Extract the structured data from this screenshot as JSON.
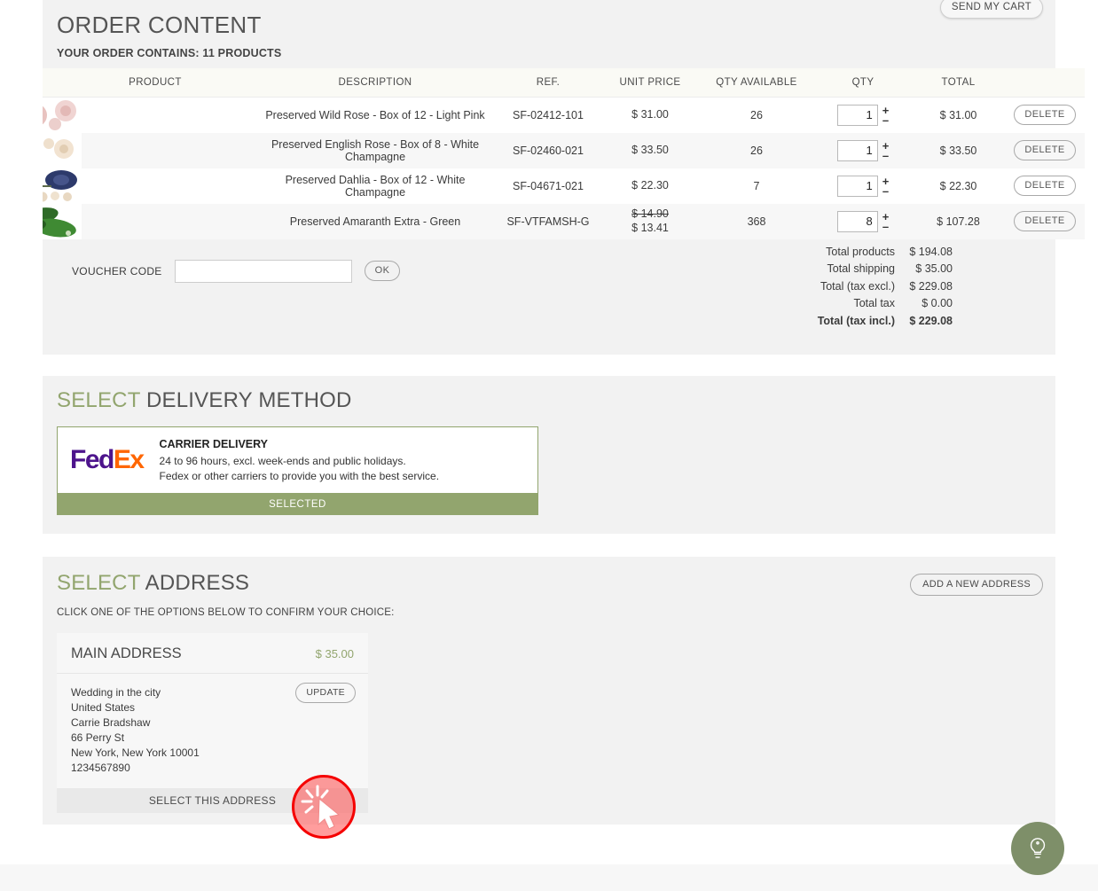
{
  "order": {
    "title": "ORDER CONTENT",
    "subtitle": "YOUR ORDER CONTAINS: 11 PRODUCTS",
    "send_cart_label": "SEND MY CART",
    "columns": {
      "product": "PRODUCT",
      "description": "DESCRIPTION",
      "ref": "REF.",
      "unit_price": "UNIT PRICE",
      "qty_available": "QTY AVAILABLE",
      "qty": "QTY",
      "total": "TOTAL"
    },
    "rows": [
      {
        "description": "Preserved Wild Rose - Box of 12 - Light Pink",
        "ref": "SF-02412-101",
        "unit_price": "$ 31.00",
        "unit_price_old": "",
        "qty_available": "26",
        "qty": "1",
        "total": "$ 31.00",
        "delete_label": "DELETE",
        "thumb": "pink-roses"
      },
      {
        "description": "Preserved English Rose - Box of 8 - White Champagne",
        "ref": "SF-02460-021",
        "unit_price": "$ 33.50",
        "unit_price_old": "",
        "qty_available": "26",
        "qty": "1",
        "total": "$ 33.50",
        "delete_label": "DELETE",
        "thumb": "cream-roses"
      },
      {
        "description": "Preserved Dahlia - Box of 12 - White Champagne",
        "ref": "SF-04671-021",
        "unit_price": "$ 22.30",
        "unit_price_old": "",
        "qty_available": "7",
        "qty": "1",
        "total": "$ 22.30",
        "delete_label": "DELETE",
        "thumb": "navy-dahlia"
      },
      {
        "description": "Preserved Amaranth Extra - Green",
        "ref": "SF-VTFAMSH-G",
        "unit_price": "$ 13.41",
        "unit_price_old": "$ 14.90",
        "qty_available": "368",
        "qty": "8",
        "total": "$ 107.28",
        "delete_label": "DELETE",
        "thumb": "green-amaranth"
      }
    ],
    "voucher": {
      "label": "VOUCHER CODE",
      "value": "",
      "placeholder": "",
      "ok_label": "OK"
    },
    "totals": [
      {
        "label": "Total products",
        "value": "$ 194.08"
      },
      {
        "label": "Total shipping",
        "value": "$ 35.00"
      },
      {
        "label": "Total (tax excl.)",
        "value": "$ 229.08"
      },
      {
        "label": "Total tax",
        "value": "$ 0.00"
      },
      {
        "label": "Total (tax incl.)",
        "value": "$ 229.08"
      }
    ],
    "stepper": {
      "plus": "+",
      "minus": "–"
    }
  },
  "delivery": {
    "title_highlight": "SELECT",
    "title_rest": " DELIVERY METHOD",
    "carrier": {
      "logo_fed": "Fed",
      "logo_ex": "Ex",
      "name": "CARRIER DELIVERY",
      "line1": "24 to 96 hours, excl. week-ends and public holidays.",
      "line2": "Fedex or other carriers to provide you with the best service."
    },
    "selected_label": "SELECTED"
  },
  "address": {
    "title_highlight": "SELECT",
    "title_rest": " ADDRESS",
    "add_new_label": "ADD A NEW ADDRESS",
    "hint": "CLICK ONE OF THE OPTIONS BELOW TO CONFIRM YOUR CHOICE:",
    "card": {
      "name": "MAIN ADDRESS",
      "price": "$ 35.00",
      "update_label": "UPDATE",
      "lines": [
        "Wedding in the city",
        "United States",
        "Carrie Bradshaw",
        "66 Perry St",
        "New York, New York 10001",
        "1234567890"
      ],
      "select_label": "SELECT THIS ADDRESS"
    }
  },
  "help": {
    "icon": "lightbulb-icon"
  },
  "colors": {
    "accent_green": "#92a56e",
    "help_green": "#7e8f69",
    "panel_bg": "#f2f2f2",
    "fedex_purple": "#4d148c",
    "fedex_orange": "#ff6600",
    "click_ring": "#f50000"
  }
}
